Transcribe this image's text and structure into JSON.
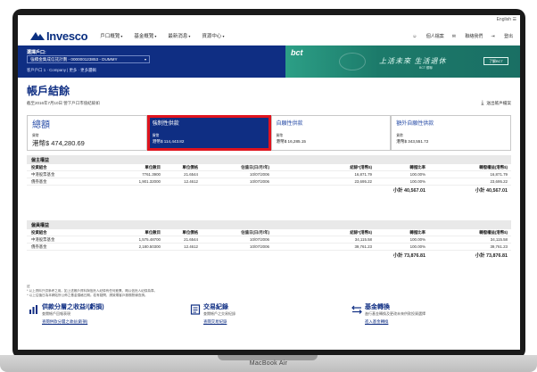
{
  "device": {
    "base_label": "MacBook Air"
  },
  "topbar": {
    "language": "English"
  },
  "header": {
    "logo": "Invesco",
    "nav": [
      "戶口概覽",
      "基金概覽",
      "最新消息",
      "資源中心"
    ],
    "right_links": [
      "個人檔案",
      "聯絡我們",
      "登出"
    ]
  },
  "account": {
    "label": "選擇戶口:",
    "selected": "強積金集成信託計劃 - 000000123853 - DUMMY",
    "breadcrumb": "客戶戶口 1 · Company | 更多 · 更多邏輯"
  },
  "banner": {
    "logo": "bct",
    "text": "上活未來 生活退休",
    "sub": "BCT 銀聯",
    "button": "了解BCT"
  },
  "page": {
    "title": "帳戶結餘",
    "subtitle": "截至2016年7月10日 營下戶口市值結餘如",
    "download": "送出帳戶檔案"
  },
  "cards": [
    {
      "title": "總額",
      "currency": "貨幣",
      "value": "港幣$ 474,280.69"
    },
    {
      "title": "強制性供款",
      "currency": "貨幣",
      "value": "港幣$ 114,443.82"
    },
    {
      "title": "自願性供款",
      "currency": "貨幣",
      "value": "港幣$ 16,285.15"
    },
    {
      "title": "額外自願性供款",
      "currency": "貨幣",
      "value": "港幣$ 343,551.72"
    }
  ],
  "table_headers": [
    "投資組合",
    "單位數目",
    "單位價格",
    "估值日(日/月/年)",
    "結餘*(港幣$)",
    "轉撥比率",
    "轉撥權益(港幣$)"
  ],
  "sections": [
    {
      "title": "僱主權益",
      "rows": [
        [
          "中港股票基金",
          "7761.3900",
          "21.6544",
          "10/07/2006",
          "16,871.79",
          "100.00%",
          "16,871.79"
        ],
        [
          "債券基金",
          "1,901.32000",
          "12.4612",
          "10/07/2006",
          "23,695.22",
          "100.00%",
          "23,695.22"
        ]
      ],
      "subtotal": "小計 40,567.01",
      "subtotal_right": "小計 40,567.01"
    },
    {
      "title": "僱員權益",
      "rows": [
        [
          "中港股票基金",
          "1,575.48700",
          "21.6544",
          "10/07/2006",
          "34,115.58",
          "100.00%",
          "34,115.58"
        ],
        [
          "債券基金",
          "2,180.50300",
          "12.4612",
          "10/07/2006",
          "39,761.23",
          "100.00%",
          "39,761.23"
        ]
      ],
      "subtotal": "小計 73,876.81",
      "subtotal_right": "小計 73,876.81"
    }
  ],
  "notes": [
    "註",
    "* 以上資料只供參考之用。如上述帳戶資料與信託人紀錄有任何差異，概以信託人紀錄為準。",
    "^ 以上估值日為本網站所公佈之基金價格日期。若有疑問，請致電客戶服務熱線查詢。"
  ],
  "quick_links": [
    {
      "title": "供款分層之收益/(虧損)",
      "desc": "查閱帳戶回報表現",
      "link": "查閱供款分層之收益(虧損)"
    },
    {
      "title": "交易紀錄",
      "desc": "查閱帳戶之交易紀錄",
      "link": "查閱交易紀錄"
    },
    {
      "title": "基金轉換",
      "desc": "進行基金轉換及更改未來供款投資選擇",
      "link": "進入基金轉換"
    }
  ],
  "colors": {
    "brand_navy": "#0f2e83",
    "highlight_red": "#e0141e",
    "banner_green": "#1c7a6a"
  }
}
